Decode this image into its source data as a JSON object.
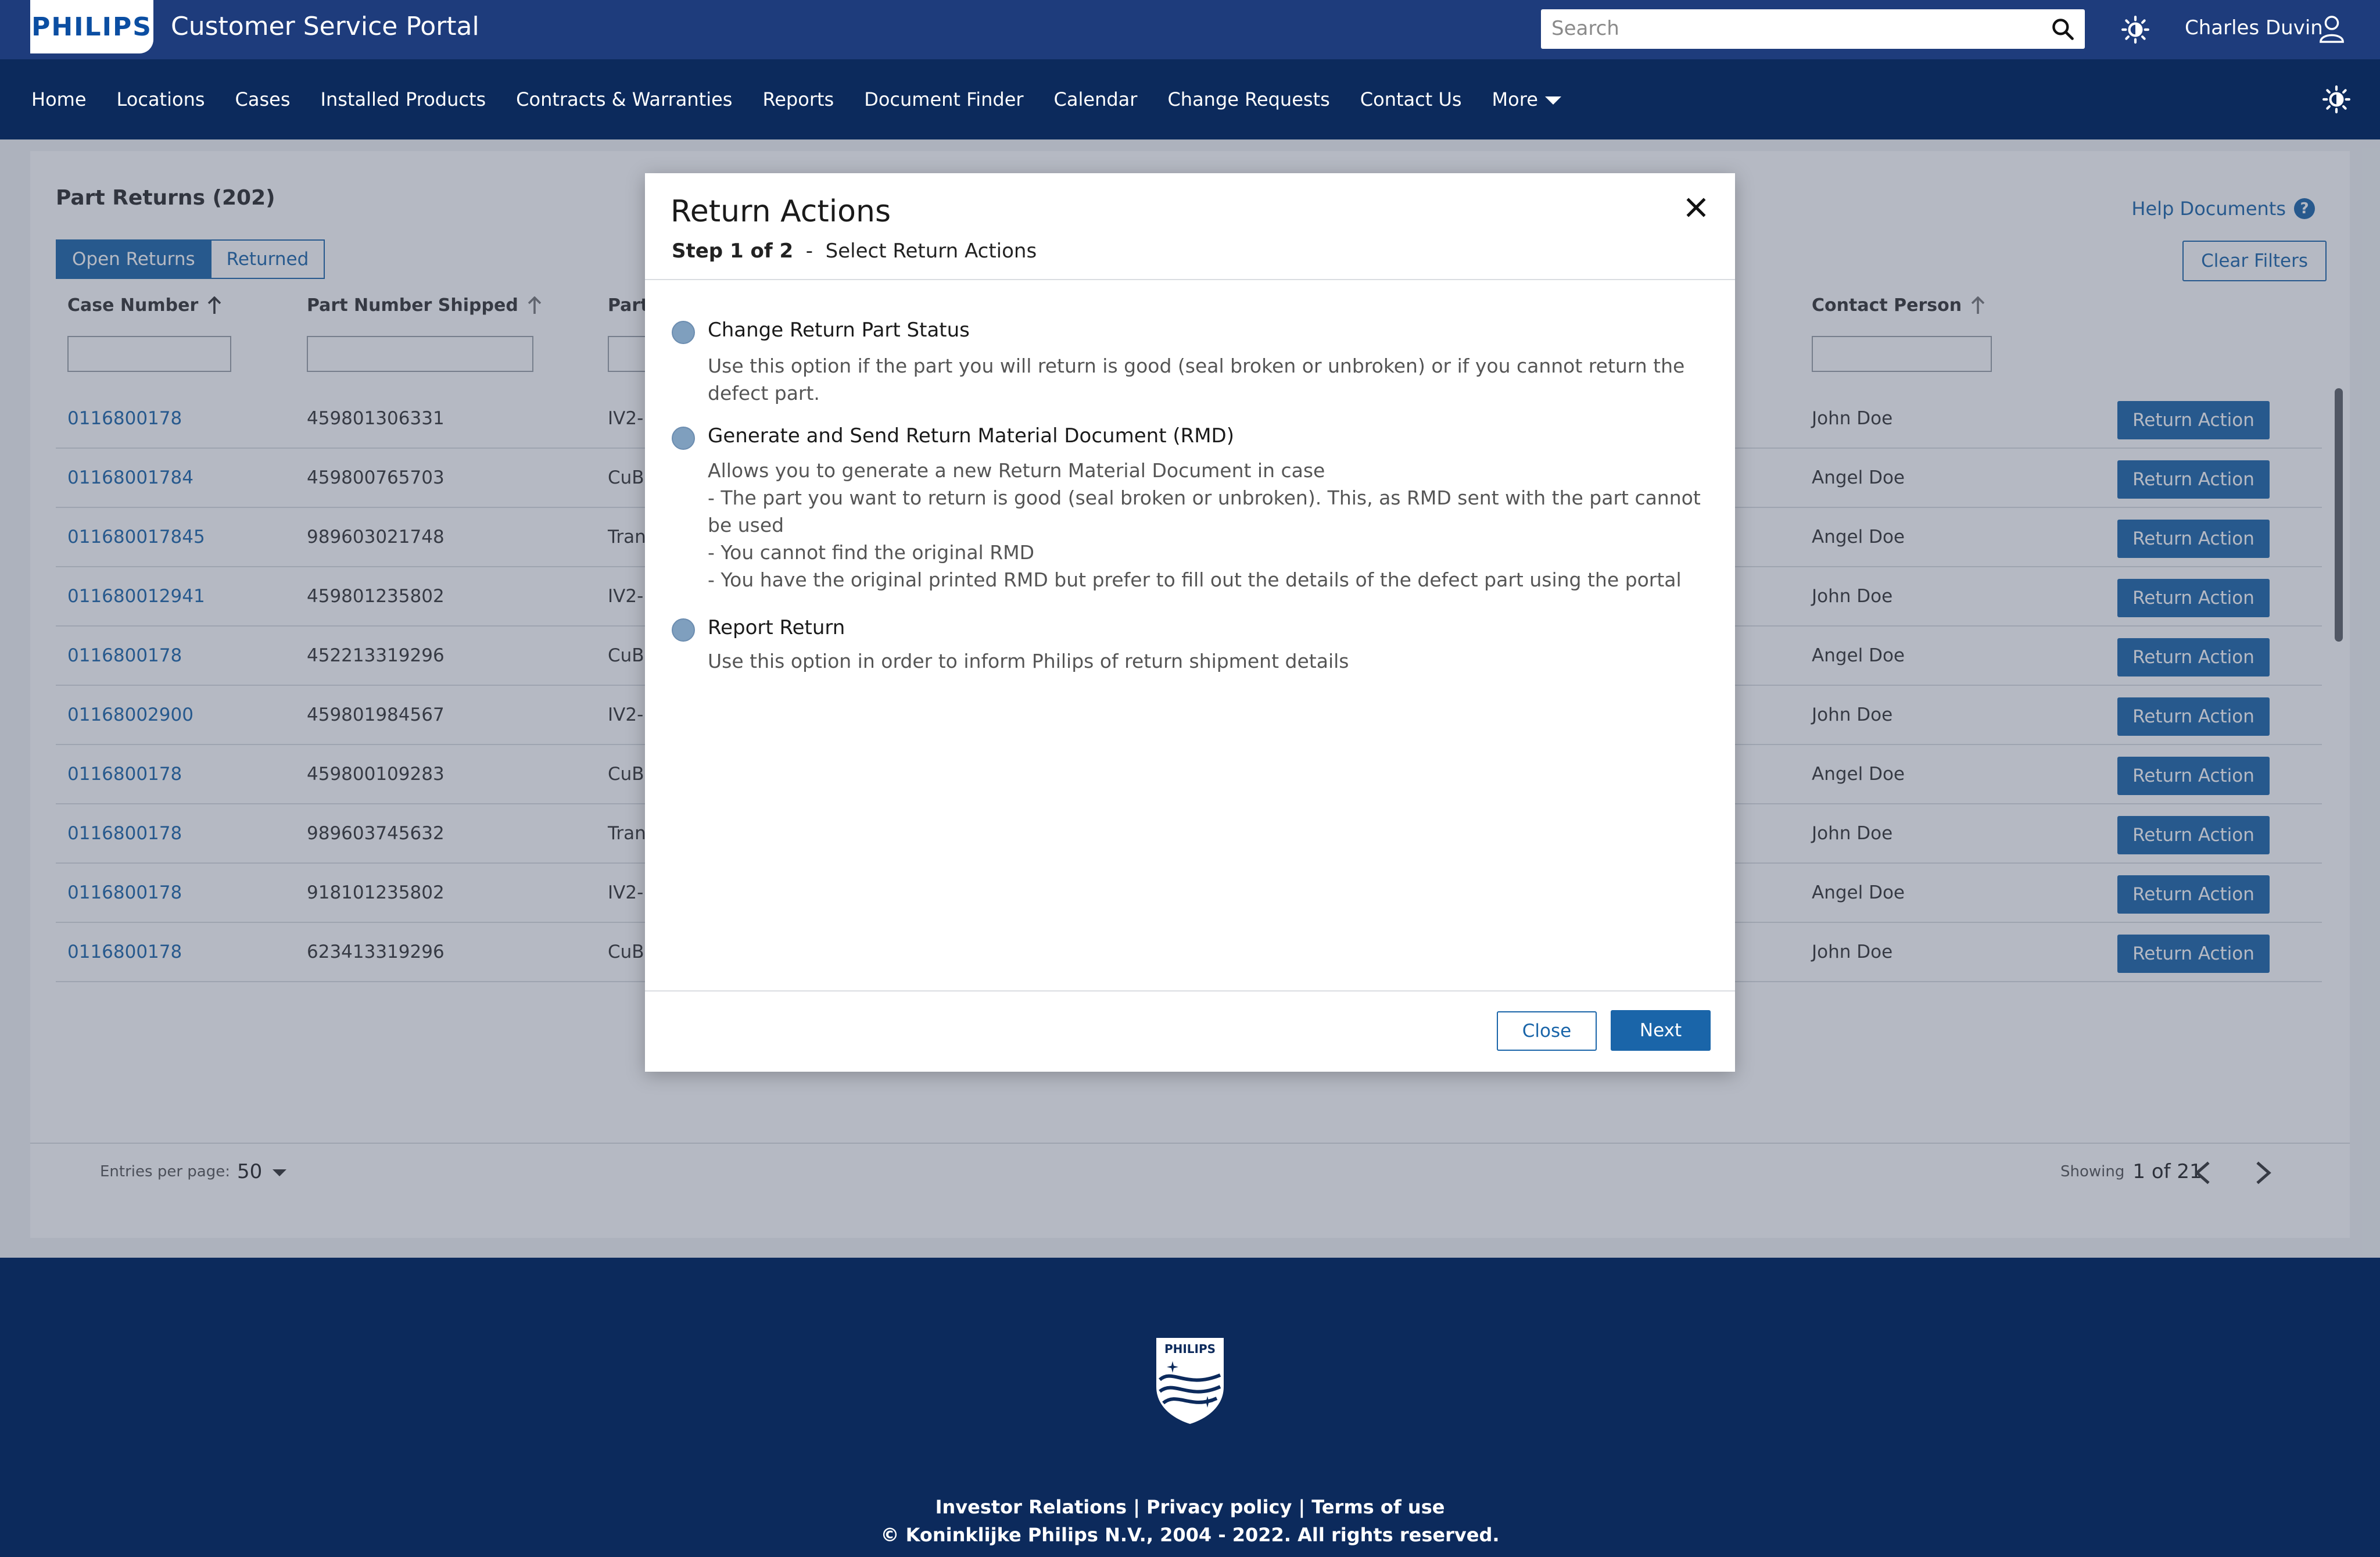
{
  "header": {
    "logo_text": "PHILIPS",
    "portal_title": "Customer Service Portal",
    "search_placeholder": "Search",
    "user_name": "Charles Duvin"
  },
  "nav": {
    "items": [
      "Home",
      "Locations",
      "Cases",
      "Installed Products",
      "Contracts & Warranties",
      "Reports",
      "Document Finder",
      "Calendar",
      "Change Requests",
      "Contact Us"
    ],
    "more_label": "More"
  },
  "page": {
    "title": "Part Returns (202)",
    "tabs": [
      "Open Returns",
      "Returned"
    ],
    "active_tab": "Open Returns",
    "help_label": "Help Documents",
    "clear_filters_label": "Clear Filters",
    "columns": [
      "Case Number",
      "Part Number Shipped",
      "Part",
      "Contact Person"
    ],
    "action_label": "Return Action",
    "rows": [
      {
        "case": "0116800178",
        "part_number": "459801306331",
        "part": "IV2-",
        "contact": "John Doe"
      },
      {
        "case": "01168001784",
        "part_number": "459800765703",
        "part": "CuBe",
        "contact": "Angel Doe"
      },
      {
        "case": "011680017845",
        "part_number": "989603021748",
        "part": "Tran",
        "contact": "Angel Doe"
      },
      {
        "case": "011680012941",
        "part_number": "459801235802",
        "part": "IV2-",
        "contact": "John Doe"
      },
      {
        "case": "0116800178",
        "part_number": "452213319296",
        "part": "CuBe",
        "contact": "Angel Doe"
      },
      {
        "case": "01168002900",
        "part_number": "459801984567",
        "part": "IV2-",
        "contact": "John Doe"
      },
      {
        "case": "0116800178",
        "part_number": "459800109283",
        "part": "CuBe",
        "contact": "Angel Doe"
      },
      {
        "case": "0116800178",
        "part_number": "989603745632",
        "part": "Tran",
        "contact": "John Doe"
      },
      {
        "case": "0116800178",
        "part_number": "918101235802",
        "part": "IV2-",
        "contact": "Angel Doe"
      },
      {
        "case": "0116800178",
        "part_number": "623413319296",
        "part": "CuBe",
        "contact": "John Doe"
      }
    ],
    "entries_label": "Entries per page:",
    "entries_value": "50",
    "showing_label": "Showing",
    "showing_value": "1 of 21"
  },
  "modal": {
    "title": "Return Actions",
    "step_label": "Step 1 of 2",
    "step_separator": "-",
    "step_text": "Select Return Actions",
    "options": [
      {
        "title": "Change Return Part Status",
        "desc_lines": [
          "Use this option if the part you will return is good (seal broken or unbroken) or if you cannot return the",
          "defect part."
        ]
      },
      {
        "title": "Generate and Send Return Material Document (RMD)",
        "desc_lines": [
          "Allows you to generate a new Return Material Document in case",
          "- The part you want to return is good (seal broken or unbroken). This, as RMD sent with the part cannot",
          "be used",
          "- You cannot find the original RMD",
          "- You have the original printed RMD but prefer to fill out the details of the defect part using the portal"
        ]
      },
      {
        "title": "Report Return",
        "desc_lines": [
          "Use this option in order to inform Philips of return shipment details"
        ]
      }
    ],
    "close_label": "Close",
    "next_label": "Next"
  },
  "footer": {
    "links": "Investor Relations | Privacy policy | Terms of use",
    "copyright": "© Koninklijke Philips N.V., 2004 - 2022. All rights reserved.",
    "logo_text": "PHILIPS"
  },
  "colors": {
    "top_bar": "#1e3c7c",
    "nav_bar": "#0c2a5c",
    "accent": "#1a65a9",
    "radio": "#7f9fbe"
  }
}
